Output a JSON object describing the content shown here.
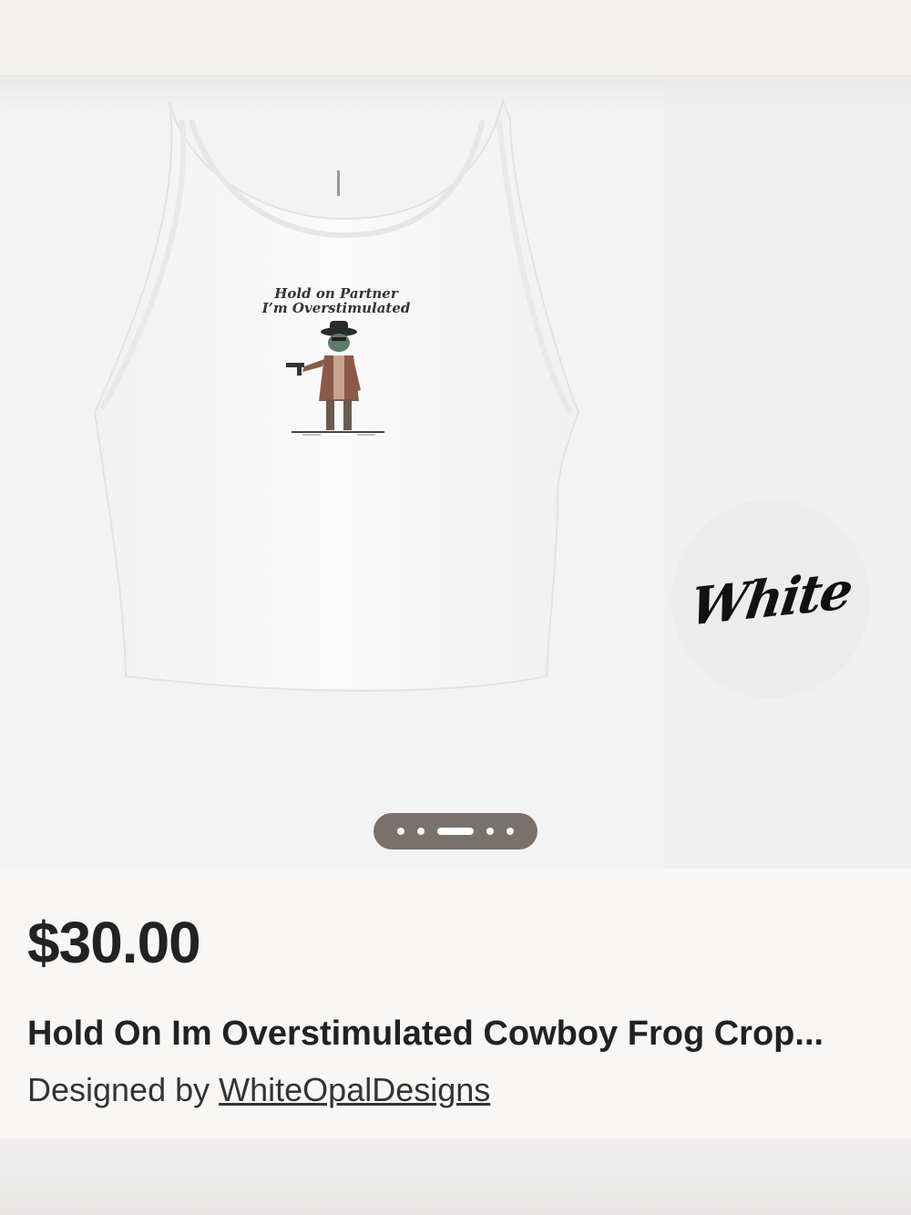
{
  "product": {
    "print_line1": "Hold on Partner",
    "print_line2": "I’m Overstimulated",
    "color_label": "White",
    "price": "$30.00",
    "title": "Hold On Im Overstimulated Cowboy Frog Crop...",
    "designed_by_prefix": "Designed by",
    "designer": "WhiteOpalDesigns"
  },
  "gallery": {
    "dot_count": 5,
    "active_dot_index": 2
  },
  "colors": {
    "pager_bg": "#7a706c",
    "tank": "#ffffff",
    "text": "#222222"
  }
}
